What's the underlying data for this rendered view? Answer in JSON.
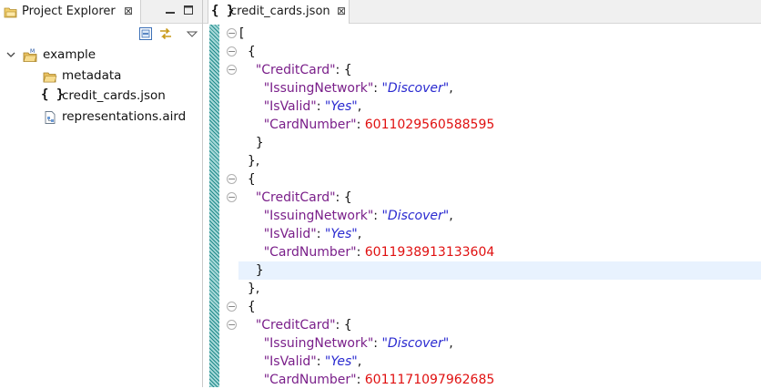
{
  "project_explorer": {
    "tab_title": "Project Explorer",
    "close_glyph": "⊠",
    "tree": [
      {
        "label": "example",
        "icon": "project-folder-icon",
        "level": 0
      },
      {
        "label": "metadata",
        "icon": "folder-icon",
        "level": 1
      },
      {
        "label": "credit_cards.json",
        "icon": "json-file-icon",
        "level": 1
      },
      {
        "label": "representations.aird",
        "icon": "aird-file-icon",
        "level": 1
      }
    ]
  },
  "editor": {
    "tab_title": "credit_cards.json",
    "tab_icon_text": "{ }",
    "close_glyph": "⊠",
    "json_icon_text": "{ }"
  },
  "code": {
    "lines": [
      [
        [
          "p",
          "["
        ]
      ],
      [
        [
          "p",
          "  {"
        ]
      ],
      [
        [
          "p",
          "    "
        ],
        [
          "k",
          "\"CreditCard\""
        ],
        [
          "p",
          ": {"
        ]
      ],
      [
        [
          "p",
          "      "
        ],
        [
          "k",
          "\"IssuingNetwork\""
        ],
        [
          "p",
          ": "
        ],
        [
          "s",
          "\"Discover\""
        ],
        [
          "p",
          ","
        ]
      ],
      [
        [
          "p",
          "      "
        ],
        [
          "k",
          "\"IsValid\""
        ],
        [
          "p",
          ": "
        ],
        [
          "s",
          "\"Yes\""
        ],
        [
          "p",
          ","
        ]
      ],
      [
        [
          "p",
          "      "
        ],
        [
          "k",
          "\"CardNumber\""
        ],
        [
          "p",
          ": "
        ],
        [
          "n",
          "6011029560588595"
        ]
      ],
      [
        [
          "p",
          "    }"
        ]
      ],
      [
        [
          "p",
          "  },"
        ]
      ],
      [
        [
          "p",
          "  {"
        ]
      ],
      [
        [
          "p",
          "    "
        ],
        [
          "k",
          "\"CreditCard\""
        ],
        [
          "p",
          ": {"
        ]
      ],
      [
        [
          "p",
          "      "
        ],
        [
          "k",
          "\"IssuingNetwork\""
        ],
        [
          "p",
          ": "
        ],
        [
          "s",
          "\"Discover\""
        ],
        [
          "p",
          ","
        ]
      ],
      [
        [
          "p",
          "      "
        ],
        [
          "k",
          "\"IsValid\""
        ],
        [
          "p",
          ": "
        ],
        [
          "s",
          "\"Yes\""
        ],
        [
          "p",
          ","
        ]
      ],
      [
        [
          "p",
          "      "
        ],
        [
          "k",
          "\"CardNumber\""
        ],
        [
          "p",
          ": "
        ],
        [
          "n",
          "6011938913133604"
        ]
      ],
      [
        [
          "p",
          "    }"
        ]
      ],
      [
        [
          "p",
          "  },"
        ]
      ],
      [
        [
          "p",
          "  {"
        ]
      ],
      [
        [
          "p",
          "    "
        ],
        [
          "k",
          "\"CreditCard\""
        ],
        [
          "p",
          ": {"
        ]
      ],
      [
        [
          "p",
          "      "
        ],
        [
          "k",
          "\"IssuingNetwork\""
        ],
        [
          "p",
          ": "
        ],
        [
          "s",
          "\"Discover\""
        ],
        [
          "p",
          ","
        ]
      ],
      [
        [
          "p",
          "      "
        ],
        [
          "k",
          "\"IsValid\""
        ],
        [
          "p",
          ": "
        ],
        [
          "s",
          "\"Yes\""
        ],
        [
          "p",
          ","
        ]
      ],
      [
        [
          "p",
          "      "
        ],
        [
          "k",
          "\"CardNumber\""
        ],
        [
          "p",
          ": "
        ],
        [
          "n",
          "6011171097962685"
        ]
      ]
    ],
    "fold_marker_lines": [
      0,
      1,
      2,
      8,
      9,
      15,
      16
    ],
    "highlighted_line": 13
  },
  "colors": {
    "key": "#7a1f8a",
    "string": "#2a2ad0",
    "number": "#e01010",
    "current_line": "#e8f2fe"
  }
}
